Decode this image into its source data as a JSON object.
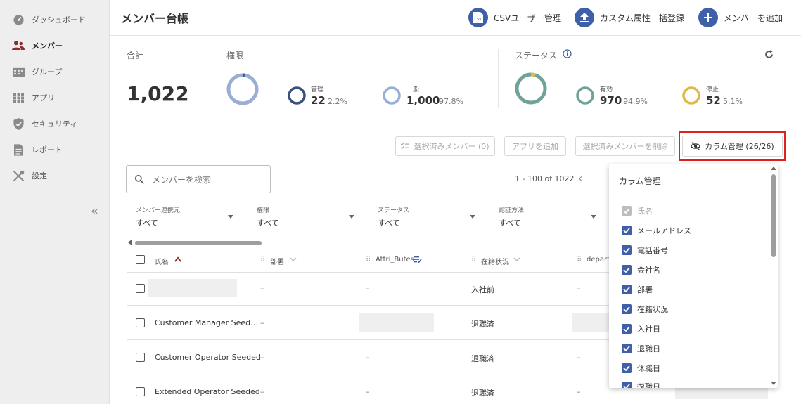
{
  "sidebar": {
    "items": [
      {
        "label": "ダッシュボード",
        "icon": "speedometer-icon"
      },
      {
        "label": "メンバー",
        "icon": "people-icon",
        "active": true
      },
      {
        "label": "グループ",
        "icon": "building-icon"
      },
      {
        "label": "アプリ",
        "icon": "grid-icon"
      },
      {
        "label": "セキュリティ",
        "icon": "shield-icon"
      },
      {
        "label": "レポート",
        "icon": "document-icon"
      },
      {
        "label": "設定",
        "icon": "tools-icon"
      }
    ],
    "collapse_label": "«"
  },
  "header": {
    "title": "メンバー台帳",
    "csv_label": "CSVユーザー管理",
    "bulk_label": "カスタム属性一括登録",
    "add_label": "メンバーを追加"
  },
  "stats": {
    "total_label": "合計",
    "total_value": "1,022",
    "role_label": "権限",
    "admin_label": "管理",
    "admin_value": "22",
    "admin_pct": "2.2%",
    "general_label": "一般",
    "general_value": "1,000",
    "general_pct": "97.8%",
    "status_label": "ステータス",
    "active_label": "有効",
    "active_value": "970",
    "active_pct": "94.9%",
    "stopped_label": "停止",
    "stopped_value": "52",
    "stopped_pct": "5.1%"
  },
  "toolbar": {
    "selected_members": "選択済みメンバー (0)",
    "add_app": "アプリを追加",
    "delete_selected": "選択済みメンバーを削除",
    "column_manage": "カラム管理 (26/26)"
  },
  "search": {
    "placeholder": "メンバーを検索",
    "value": ""
  },
  "pagination": {
    "range": "1 - 100 of 1022",
    "prev": "‹"
  },
  "filters": [
    {
      "label": "メンバー連携元",
      "value": "すべて"
    },
    {
      "label": "権限",
      "value": "すべて"
    },
    {
      "label": "ステータス",
      "value": "すべて"
    },
    {
      "label": "認証方法",
      "value": "すべて"
    }
  ],
  "table": {
    "columns": [
      "氏名",
      "部署",
      "Attri_Butes",
      "在籍状況",
      "departn"
    ],
    "rows": [
      {
        "name": "",
        "dept": "–",
        "attr": "–",
        "status": "入社前",
        "extra": "–"
      },
      {
        "name": "Customer Manager Seed…",
        "dept": "–",
        "attr": "",
        "status": "退職済",
        "extra": ""
      },
      {
        "name": "Customer Operator Seeded",
        "dept": "–",
        "attr": "–",
        "status": "退職済",
        "extra": "–"
      },
      {
        "name": "Extended Operator Seeded",
        "dept": "–",
        "attr": "–",
        "status": "退職済",
        "extra": "–"
      }
    ]
  },
  "column_panel": {
    "title": "カラム管理",
    "items": [
      {
        "label": "氏名",
        "disabled": true
      },
      {
        "label": "メールアドレス"
      },
      {
        "label": "電話番号"
      },
      {
        "label": "会社名"
      },
      {
        "label": "部署"
      },
      {
        "label": "在籍状況"
      },
      {
        "label": "入社日"
      },
      {
        "label": "退職日"
      },
      {
        "label": "休職日"
      },
      {
        "label": "復職日"
      }
    ]
  },
  "colors": {
    "accent": "#3f5fa8",
    "admin_ring": "#3a4f7d",
    "general_ring": "#9aaed4",
    "active_ring": "#6fa39a",
    "stopped_ring": "#e0b84a",
    "highlight": "#e02020"
  }
}
